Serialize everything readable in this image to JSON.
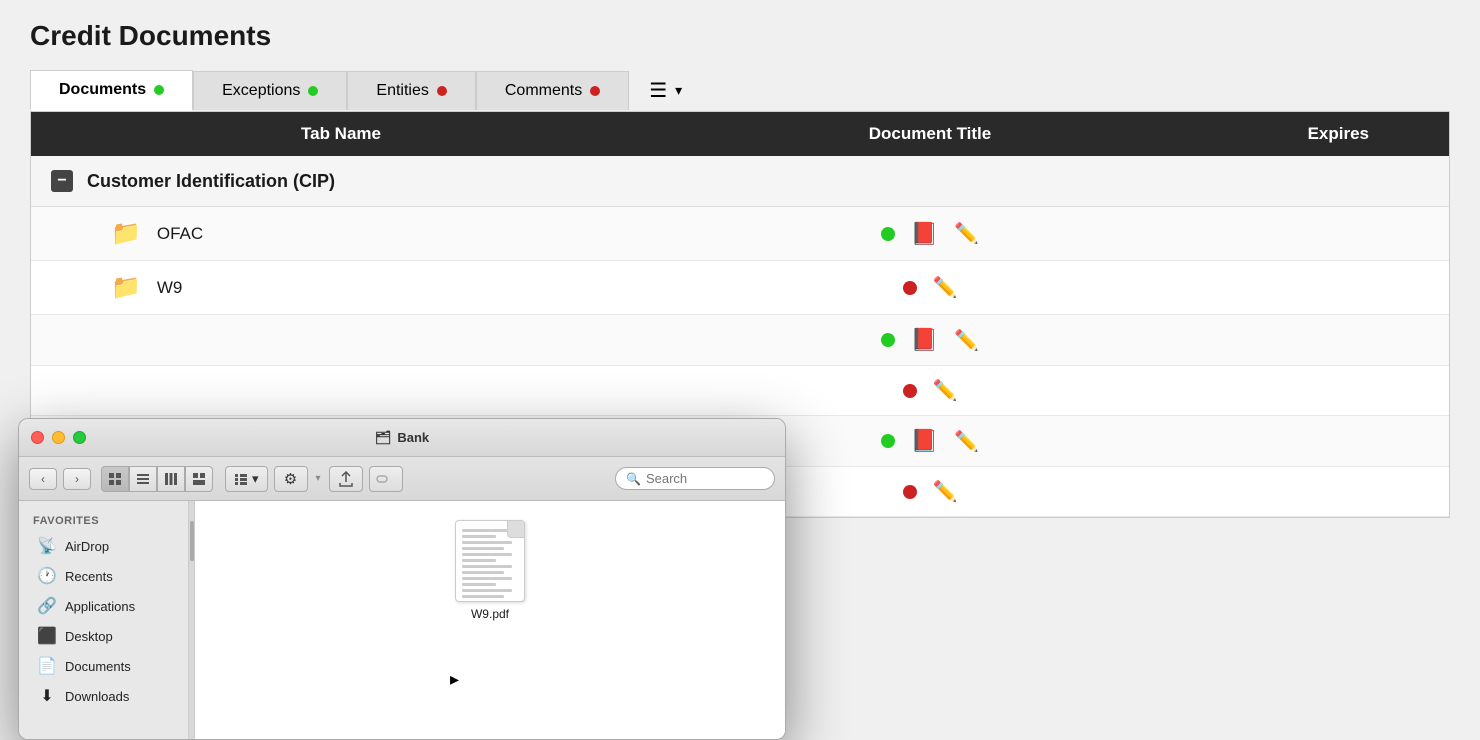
{
  "page": {
    "title": "Credit Documents"
  },
  "tabs": [
    {
      "id": "documents",
      "label": "Documents",
      "dot": "green",
      "active": true
    },
    {
      "id": "exceptions",
      "label": "Exceptions",
      "dot": "green",
      "active": false
    },
    {
      "id": "entities",
      "label": "Entities",
      "dot": "red",
      "active": false
    },
    {
      "id": "comments",
      "label": "Comments",
      "dot": "red",
      "active": false
    }
  ],
  "table": {
    "headers": {
      "tab_name": "Tab Name",
      "document_title": "Document Title",
      "expires": "Expires"
    },
    "section": {
      "title": "Customer Identification (CIP)",
      "collapse_symbol": "−"
    },
    "rows": [
      {
        "id": "ofac",
        "name": "OFAC",
        "status": "green",
        "has_pdf": true,
        "has_edit": true
      },
      {
        "id": "w9",
        "name": "W9",
        "status": "red",
        "has_pdf": false,
        "has_edit": true
      },
      {
        "id": "row3",
        "name": "",
        "status": "green",
        "has_pdf": true,
        "has_edit": true
      },
      {
        "id": "row4",
        "name": "",
        "status": "red",
        "has_pdf": false,
        "has_edit": true
      },
      {
        "id": "row5",
        "name": "",
        "status": "green",
        "has_pdf": true,
        "has_edit": true
      },
      {
        "id": "row6",
        "name": "",
        "status": "red",
        "has_pdf": false,
        "has_edit": true
      }
    ]
  },
  "finder": {
    "title": "Bank",
    "title_icon": "🗂",
    "search_placeholder": "Search",
    "sidebar": {
      "section": "Favorites",
      "items": [
        {
          "id": "airdrop",
          "label": "AirDrop",
          "icon": "📡"
        },
        {
          "id": "recents",
          "label": "Recents",
          "icon": "🕐"
        },
        {
          "id": "applications",
          "label": "Applications",
          "icon": "🔗"
        },
        {
          "id": "desktop",
          "label": "Desktop",
          "icon": "⬛"
        },
        {
          "id": "documents",
          "label": "Documents",
          "icon": "📄"
        },
        {
          "id": "downloads",
          "label": "Downloads",
          "icon": "⬇"
        }
      ]
    },
    "file": {
      "name": "W9.pdf",
      "type": "pdf"
    },
    "toolbar": {
      "back_symbol": "‹",
      "forward_symbol": "›",
      "gear_symbol": "⚙",
      "share_symbol": "↑",
      "tag_symbol": "◯",
      "dropdown_symbol": "▾"
    }
  }
}
